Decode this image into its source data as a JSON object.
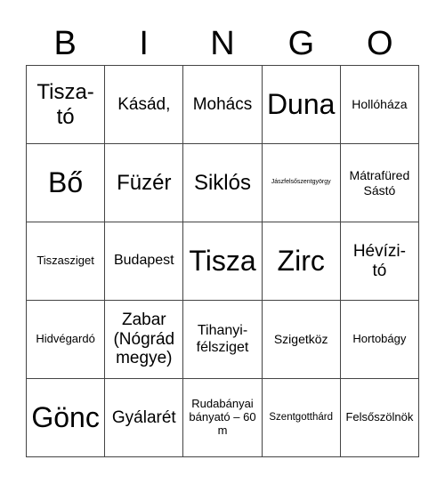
{
  "header": {
    "letters": [
      "B",
      "I",
      "N",
      "G",
      "O"
    ]
  },
  "cells": [
    {
      "text": "Tisza-\ntó"
    },
    {
      "text": "Kásád,"
    },
    {
      "text": "Mohács"
    },
    {
      "text": "Duna"
    },
    {
      "text": "Hollóháza"
    },
    {
      "text": "Bő"
    },
    {
      "text": "Füzér"
    },
    {
      "text": "Siklós"
    },
    {
      "text": "Jászfelsőszentgyörgy"
    },
    {
      "text": "Mátrafüred Sástó"
    },
    {
      "text": "Tiszasziget"
    },
    {
      "text": "Budapest"
    },
    {
      "text": "Tisza"
    },
    {
      "text": "Zirc"
    },
    {
      "text": "Hévízi-\ntó"
    },
    {
      "text": "Hidvégardó"
    },
    {
      "text": "Zabar (Nógrád megye)"
    },
    {
      "text": "Tihanyi-\nfélsziget"
    },
    {
      "text": "Szigetköz"
    },
    {
      "text": "Hortobágy"
    },
    {
      "text": "Gönc"
    },
    {
      "text": "Gyálarét"
    },
    {
      "text": "Rudabányai bányató – 60 m"
    },
    {
      "text": "Szentgotthárd"
    },
    {
      "text": "Felsőszölnök"
    }
  ]
}
